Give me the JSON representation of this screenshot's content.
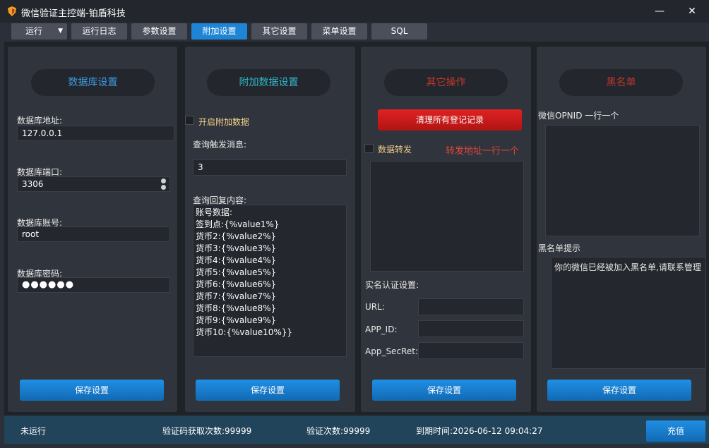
{
  "window": {
    "title": "微信验证主控端-铂盾科技",
    "minimize": "—",
    "close": "✕"
  },
  "tabs": [
    "运行",
    "运行日志",
    "参数设置",
    "附加设置",
    "其它设置",
    "菜单设置",
    "SQL"
  ],
  "active_tab": "附加设置",
  "db_panel": {
    "heading": "数据库设置",
    "address_label": "数据库地址:",
    "address_value": "127.0.0.1",
    "port_label": "数据库端口:",
    "port_value": "3306",
    "account_label": "数据库账号:",
    "account_value": "root",
    "password_label": "数据库密码:",
    "password_value": "●●●●●●",
    "save": "保存设置"
  },
  "extra_panel": {
    "heading": "附加数据设置",
    "enable_label": "开启附加数据",
    "trigger_label": "查询触发消息:",
    "trigger_value": "3",
    "reply_label": "查询回复内容:",
    "reply_lines": [
      "账号数据:",
      "签到点:{%value1%}",
      "货币2:{%value2%}",
      "货币3:{%value3%}",
      "货币4:{%value4%}",
      "货币5:{%value5%}",
      "货币6:{%value6%}",
      "货币7:{%value7%}",
      "货币8:{%value8%}",
      "货币9:{%value9%}",
      "货币10:{%value10%}}"
    ],
    "save": "保存设置"
  },
  "other_panel": {
    "heading": "其它操作",
    "clear_button": "清理所有登记记录",
    "forward_label": "数据转发",
    "forward_hint": "转发地址一行一个",
    "realname_label": "实名认证设置:",
    "url_label": "URL:",
    "appid_label": "APP_ID:",
    "secret_label": "App_SecRet:",
    "save": "保存设置"
  },
  "blacklist_panel": {
    "heading": "黑名单",
    "openid_label": "微信OPNID  一行一个",
    "tip_label": "黑名单提示",
    "tip_value": "你的微信已经被加入黑名单,请联系管理",
    "save": "保存设置"
  },
  "status": {
    "state": "未运行",
    "code_count": "验证码获取次数:99999",
    "verify_count": "验证次数:99999",
    "expire": "到期时间:2026-06-12 09:04:27",
    "recharge": "充值"
  },
  "colors": {
    "accent": "#1e84d6",
    "heading_blue": "#3d9ae0",
    "heading_teal": "#2fb6c7",
    "heading_red": "#c0392b",
    "danger_button": "#d41e1e",
    "label_yellow": "#f1d08a",
    "hint_red": "#e2463b"
  }
}
